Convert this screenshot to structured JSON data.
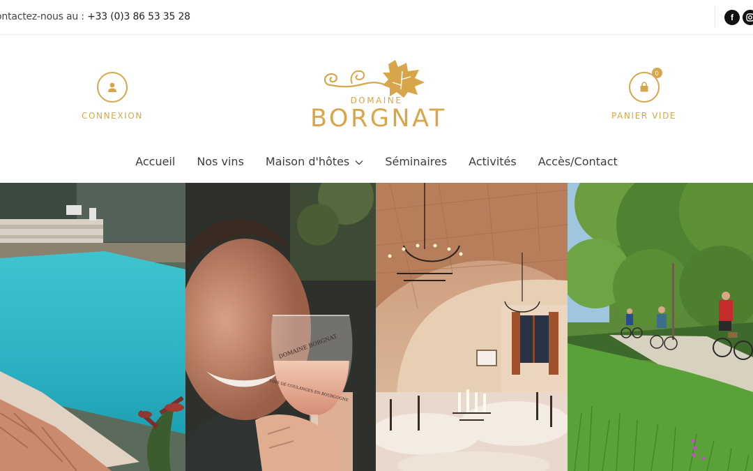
{
  "topbar": {
    "contact_prefix": "ontactez-nous au :",
    "phone": "+33 (0)3 86 53 35 28",
    "social": [
      {
        "icon": "facebook-icon",
        "glyph": "f"
      },
      {
        "icon": "instagram-icon",
        "glyph": "◎"
      }
    ]
  },
  "header": {
    "login_label": "CONNEXION",
    "cart_label": "PANIER VIDE",
    "cart_count": "0",
    "brand_top": "DOMAINE",
    "brand_main": "BORGNAT"
  },
  "nav": {
    "items": [
      "Accueil",
      "Nos vins",
      "Maison d'hôtes",
      "Séminaires",
      "Activités",
      "Accès/Contact"
    ]
  },
  "gallery": {
    "glass_text_1": "DOMAINE BORGNAT",
    "glass_text_2": "VINS DE COULANGES EN BOURGOGNE"
  },
  "colors": {
    "accent": "#d8a64a",
    "text": "#3d3d3d"
  }
}
